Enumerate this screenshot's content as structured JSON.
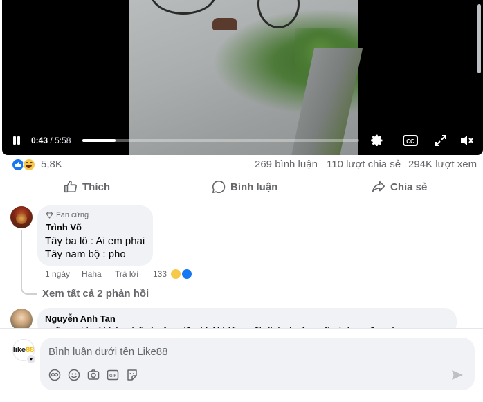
{
  "video": {
    "current_time": "0:43",
    "separator": " / ",
    "duration": "5:58",
    "progress_fraction": 0.12,
    "controls": [
      "pause-icon",
      "settings-gear-icon",
      "closed-captions-icon",
      "fullscreen-icon",
      "mute-icon"
    ],
    "cc_label": "CC"
  },
  "stats": {
    "reaction_icons": [
      "like-icon",
      "haha-icon"
    ],
    "reaction_count": "5,8K",
    "comments": "269 bình luận",
    "shares": "110 lượt chia sẻ",
    "views": "294K lượt xem"
  },
  "actions": {
    "like": "Thích",
    "comment": "Bình luận",
    "share": "Chia sẻ"
  },
  "comments": [
    {
      "badge": "Fan cứng",
      "author": "Trình Võ",
      "lines": [
        "Tây ba lô : Ai em phai",
        "Tây nam bộ : pho"
      ],
      "time": "1 ngày",
      "reaction_action": "Haha",
      "reply": "Trả lời",
      "reaction_count": "133",
      "see_replies": "Xem tất cả 2 phản hồi"
    },
    {
      "author": "Nguyễn Anh Tan",
      "preview": "Trốn trại hoài hèn thể vì vậy Hiền khôi hiểu Mối dịch thuật ngữ chứ... Về ...rà"
    }
  ],
  "composer": {
    "avatar_text_1": "like",
    "avatar_text_2": "88",
    "placeholder": "Bình luận dưới tên Like88",
    "gif_label": "GIF",
    "tools": [
      "avatar-sticker-icon",
      "emoji-icon",
      "camera-icon",
      "gif-icon",
      "sticker-icon"
    ],
    "send_icon": "send-icon"
  },
  "colors": {
    "accent": "#1877f2",
    "haha_yellow": "#f7c94a",
    "muted_text": "#65676b",
    "bubble_bg": "#f0f2f5"
  }
}
